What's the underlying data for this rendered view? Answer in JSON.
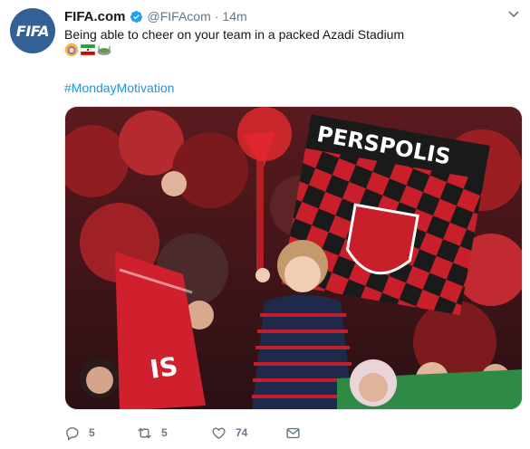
{
  "tweet": {
    "avatar_text": "FIFA",
    "display_name": "FIFA.com",
    "handle": "@FIFAcom",
    "separator": "·",
    "time": "14m",
    "text": "Being able to cheer on your team in a packed Azadi Stadium",
    "emojis": [
      "lion-sun-emoji",
      "iran-flag-emoji",
      "stadium-emoji"
    ],
    "hashtag": "#MondayMotivation",
    "media": {
      "banner_text": "PERSPOLIS",
      "flag_text": "IS"
    },
    "actions": {
      "replies": "5",
      "retweets": "5",
      "likes": "74"
    }
  },
  "colors": {
    "brand_blue": "#326295",
    "link_blue": "#1b95e0",
    "secondary_text": "#657786",
    "perspolis_red": "#d0202e"
  }
}
